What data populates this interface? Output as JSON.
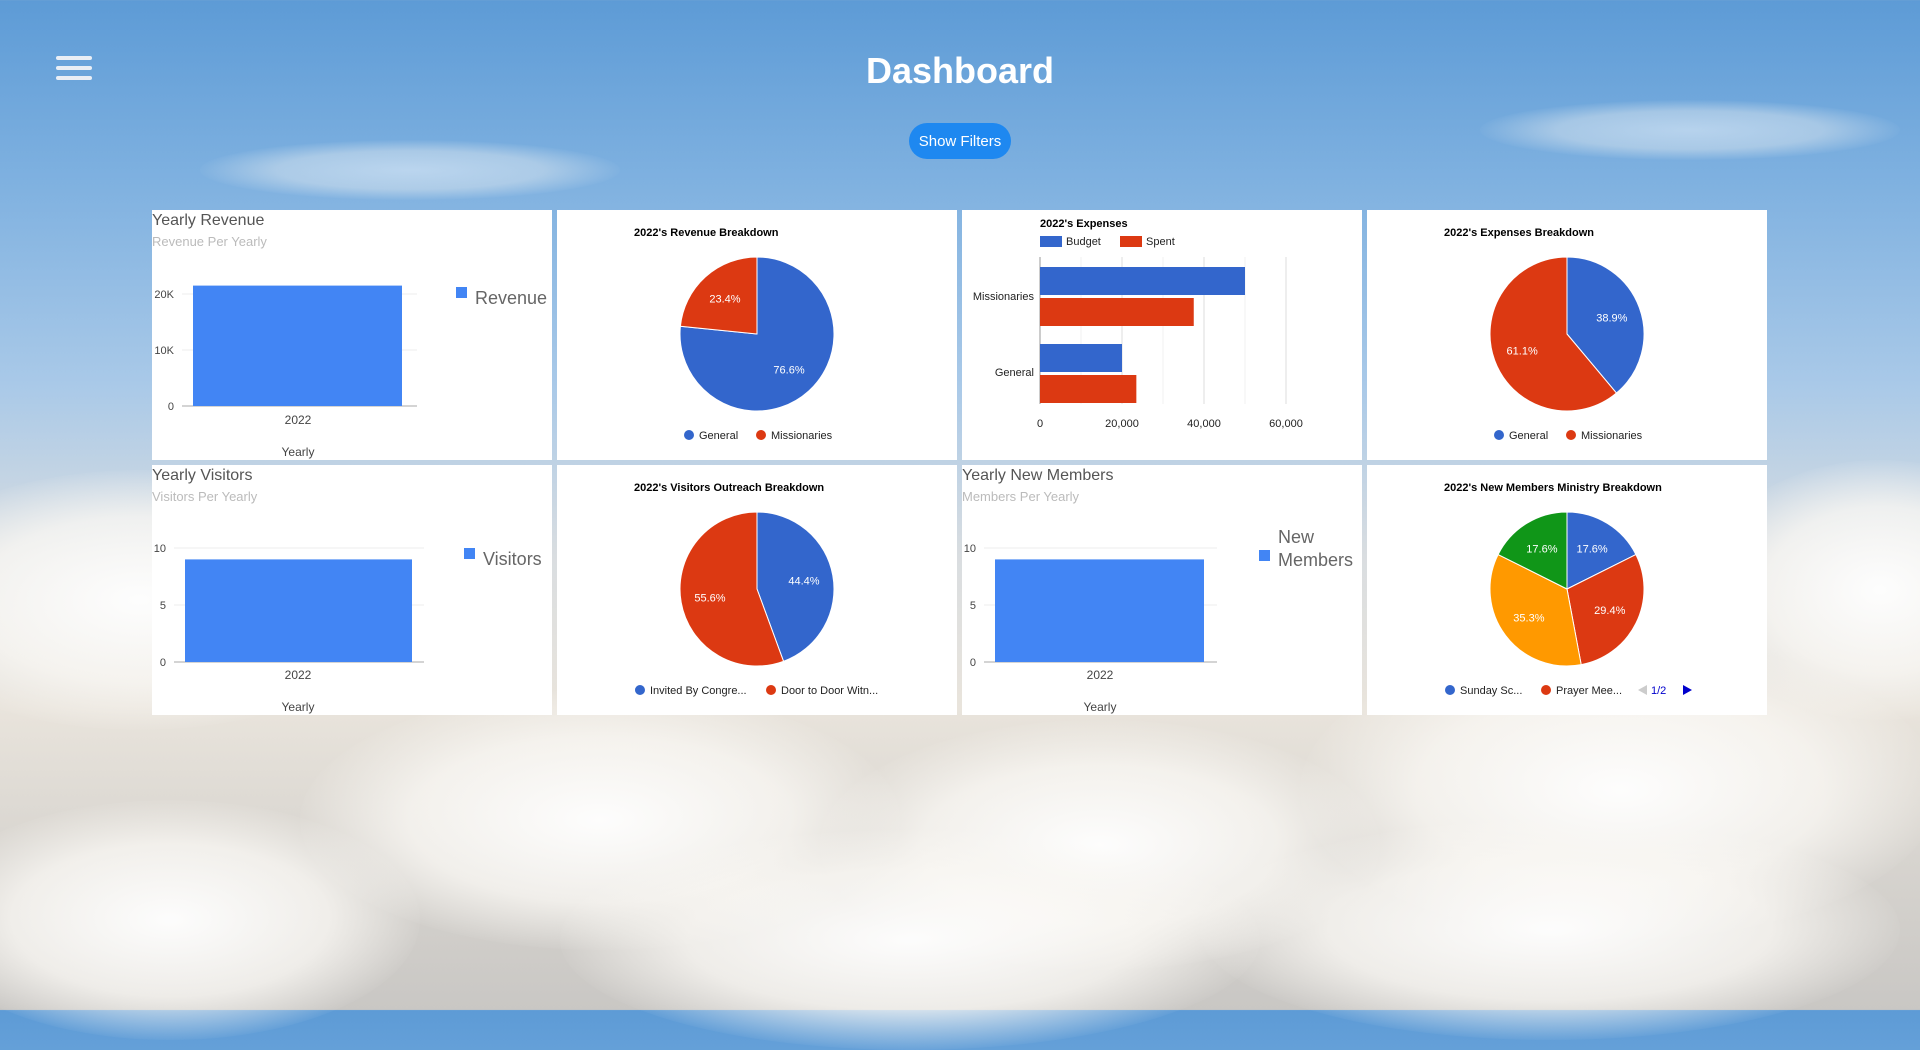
{
  "header": {
    "title": "Dashboard",
    "filters_button": "Show Filters"
  },
  "colors": {
    "blue": "#3366cc",
    "bar_blue": "#4285f4",
    "red": "#dc3912",
    "orange": "#ff9900",
    "green": "#109618"
  },
  "charts": {
    "revenue": {
      "title": "Yearly Revenue",
      "subtitle": "Revenue Per Yearly",
      "chart_data": {
        "type": "bar",
        "categories": [
          "2022"
        ],
        "series": [
          {
            "name": "Revenue",
            "values": [
              21500
            ]
          }
        ],
        "xlabel": "Yearly",
        "ylim": [
          0,
          24000
        ],
        "yticks": [
          "0",
          "10K",
          "20K"
        ],
        "legend": "right"
      }
    },
    "revenue_breakdown": {
      "chart_data": {
        "type": "pie",
        "title": "2022's Revenue Breakdown",
        "labels": [
          "General",
          "Missionaries"
        ],
        "values": [
          76.6,
          23.4
        ],
        "value_labels": [
          "76.6%",
          "23.4%"
        ],
        "legend": "bottom"
      }
    },
    "expenses": {
      "chart_data": {
        "type": "bar",
        "orientation": "horizontal",
        "title": "2022's Expenses",
        "categories": [
          "Missionaries",
          "General"
        ],
        "series": [
          {
            "name": "Budget",
            "values": [
              50000,
              20000
            ]
          },
          {
            "name": "Spent",
            "values": [
              37500,
              23500
            ]
          }
        ],
        "xlim": [
          0,
          60000
        ],
        "xticks": [
          "0",
          "20,000",
          "40,000",
          "60,000"
        ],
        "legend": "top"
      }
    },
    "expenses_breakdown": {
      "chart_data": {
        "type": "pie",
        "title": "2022's Expenses Breakdown",
        "labels": [
          "General",
          "Missionaries"
        ],
        "values": [
          38.9,
          61.1
        ],
        "value_labels": [
          "38.9%",
          "61.1%"
        ],
        "legend": "bottom"
      }
    },
    "visitors": {
      "title": "Yearly Visitors",
      "subtitle": "Visitors Per Yearly",
      "chart_data": {
        "type": "bar",
        "categories": [
          "2022"
        ],
        "series": [
          {
            "name": "Visitors",
            "values": [
              9
            ]
          }
        ],
        "xlabel": "Yearly",
        "ylim": [
          0,
          10
        ],
        "yticks": [
          "0",
          "5",
          "10"
        ],
        "legend": "right"
      }
    },
    "visitors_breakdown": {
      "chart_data": {
        "type": "pie",
        "title": "2022's Visitors Outreach Breakdown",
        "labels": [
          "Invited By Congre...",
          "Door to Door Witn..."
        ],
        "values": [
          44.4,
          55.6
        ],
        "value_labels": [
          "44.4%",
          "55.6%"
        ],
        "legend": "bottom"
      }
    },
    "members": {
      "title": "Yearly New Members",
      "subtitle": "Members Per Yearly",
      "chart_data": {
        "type": "bar",
        "categories": [
          "2022"
        ],
        "series": [
          {
            "name": "New Members",
            "values": [
              9
            ]
          }
        ],
        "legend_lines": [
          "New",
          "Members"
        ],
        "xlabel": "Yearly",
        "ylim": [
          0,
          10
        ],
        "yticks": [
          "0",
          "5",
          "10"
        ],
        "legend": "right"
      }
    },
    "members_breakdown": {
      "chart_data": {
        "type": "pie",
        "title": "2022's New Members Ministry Breakdown",
        "labels": [
          "Sunday Sc...",
          "Prayer Mee..."
        ],
        "values": [
          17.6,
          29.4,
          35.3,
          17.6
        ],
        "value_labels": [
          "17.6%",
          "29.4%",
          "35.3%",
          "17.6%"
        ],
        "legend": "bottom",
        "legend_page": "1/2"
      }
    }
  }
}
